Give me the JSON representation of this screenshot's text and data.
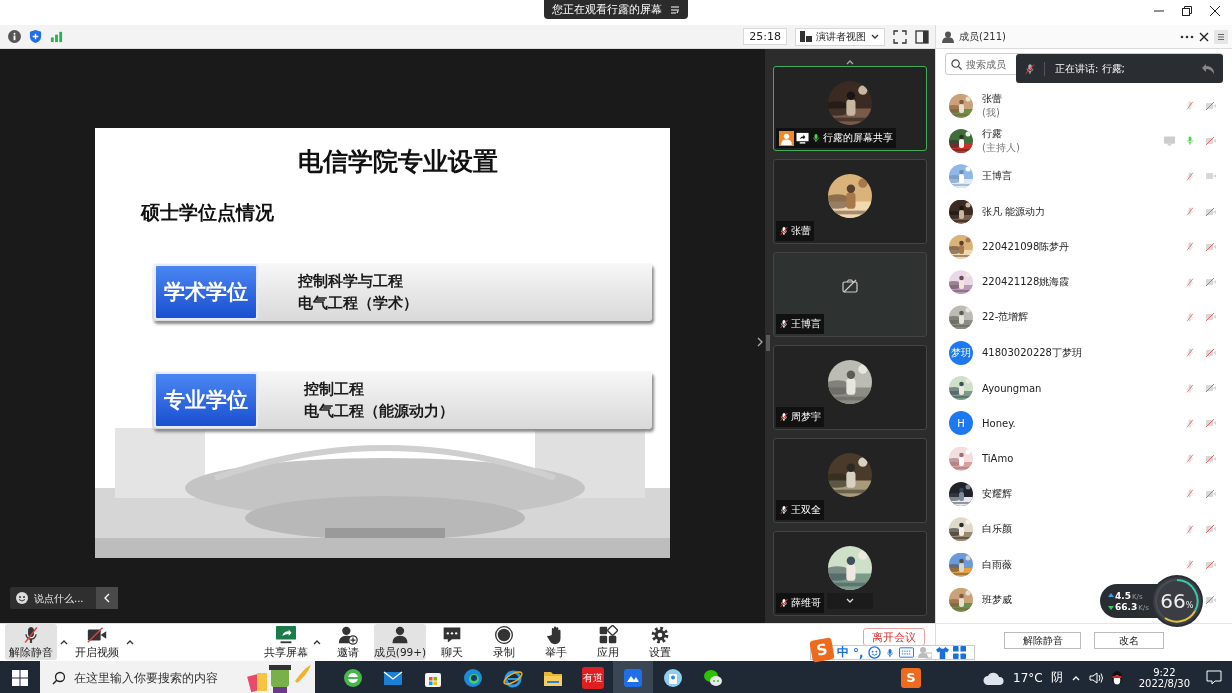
{
  "viewing_banner": {
    "text": "您正在观看行露的屏幕"
  },
  "toolbar": {
    "timer": "25:18",
    "view_mode": "演讲者视图"
  },
  "stage": {
    "slide": {
      "title": "电信学院专业设置",
      "subtitle": "硕士学位点情况",
      "degrees": [
        {
          "label": "学术学位",
          "programs": [
            "控制科学与工程",
            "电气工程（学术）"
          ]
        },
        {
          "label": "专业学位",
          "programs": [
            "控制工程",
            "电气工程（能源动力）"
          ]
        }
      ]
    },
    "chat_placeholder": "说点什么..."
  },
  "thumbnails": [
    {
      "kind": "host",
      "label": "行露的屏幕共享",
      "muted": false,
      "active": true
    },
    {
      "kind": "picture",
      "label": "张蕾",
      "muted": true,
      "active": false
    },
    {
      "kind": "camera-off",
      "label": "王博言",
      "muted": true,
      "active": false
    },
    {
      "kind": "picture",
      "label": "周梦宇",
      "muted": true,
      "active": false
    },
    {
      "kind": "picture",
      "label": "王双全",
      "muted": true,
      "active": false
    },
    {
      "kind": "picture",
      "label": "薛维哥",
      "muted": true,
      "active": false
    }
  ],
  "members_panel": {
    "title": "成员(211)",
    "search": {
      "placeholder": "搜索成员"
    },
    "speaking_toast": "正在讲话: 行露;",
    "members": [
      {
        "name": "张蕾",
        "role": "(我)",
        "mic_muted": true,
        "sharing": false,
        "video_off": true
      },
      {
        "name": "行露",
        "role": "(主持人)",
        "mic_muted": false,
        "sharing": true,
        "video_off": true
      },
      {
        "name": "王博言",
        "mic_muted": true,
        "sharing": false,
        "video_off": false
      },
      {
        "name": "张凡 能源动力",
        "mic_muted": true,
        "sharing": false,
        "video_off": true
      },
      {
        "name": "220421098陈梦丹",
        "mic_muted": true,
        "sharing": false,
        "video_off": true
      },
      {
        "name": "220421128姚海霞",
        "mic_muted": true,
        "sharing": false,
        "video_off": true
      },
      {
        "name": "22-范增辉",
        "mic_muted": true,
        "sharing": false,
        "video_off": true
      },
      {
        "name": "41803020228丁梦玥",
        "avatar": {
          "kind": "letter",
          "text": "梦玥"
        },
        "mic_muted": true,
        "sharing": false,
        "video_off": true
      },
      {
        "name": "Ayoungman",
        "mic_muted": true,
        "sharing": false,
        "video_off": true
      },
      {
        "name": "Honey.",
        "avatar": {
          "kind": "letter",
          "text": "H"
        },
        "mic_muted": true,
        "sharing": false,
        "video_off": true
      },
      {
        "name": "TiAmo",
        "mic_muted": true,
        "sharing": false,
        "video_off": true
      },
      {
        "name": "安耀辉",
        "mic_muted": true,
        "sharing": false,
        "video_off": true
      },
      {
        "name": "白乐颜",
        "mic_muted": true,
        "sharing": false,
        "video_off": true
      },
      {
        "name": "白雨薇",
        "mic_muted": true,
        "sharing": false,
        "video_off": true
      },
      {
        "name": "班梦威",
        "sharing": false,
        "video_off": true
      }
    ],
    "footer_buttons": [
      "解除静音",
      "改名"
    ]
  },
  "network_widget": {
    "upload": {
      "value": "4.5",
      "unit": "K/s"
    },
    "download": {
      "value": "66.3",
      "unit": "K/s"
    },
    "usage": "66",
    "usage_unit": "%"
  },
  "meeting_toolbar": {
    "left_controls": [
      {
        "kind": "mic-muted",
        "label": "解除静音",
        "caret": true,
        "highlighted": true
      },
      {
        "kind": "video-off",
        "label": "开启视频",
        "caret": true,
        "highlighted": false
      }
    ],
    "center_controls": [
      {
        "kind": "share",
        "label": "共享屏幕",
        "caret": true,
        "highlighted": false
      },
      {
        "kind": "invite",
        "label": "邀请",
        "caret": false,
        "highlighted": false
      },
      {
        "kind": "members",
        "label": "成员(99+)",
        "caret": false,
        "highlighted": true
      },
      {
        "kind": "chat",
        "label": "聊天",
        "caret": false,
        "highlighted": false
      },
      {
        "kind": "record",
        "label": "录制",
        "caret": false,
        "highlighted": false
      },
      {
        "kind": "hand",
        "label": "举手",
        "caret": false,
        "highlighted": false
      },
      {
        "kind": "apps",
        "label": "应用",
        "caret": false,
        "highlighted": false
      },
      {
        "kind": "settings",
        "label": "设置",
        "caret": false,
        "highlighted": false
      }
    ],
    "leave_button": "离开会议"
  },
  "ime_bar": {
    "logo": "S",
    "mode": "中",
    "punct": "°,"
  },
  "taskbar": {
    "search_placeholder": "在这里输入你要搜索的内容",
    "apps": [
      {
        "kind": "edge-legacy",
        "active": false
      },
      {
        "kind": "mail",
        "active": false
      },
      {
        "kind": "store",
        "active": false
      },
      {
        "kind": "edge",
        "active": false
      },
      {
        "kind": "ie",
        "active": false
      },
      {
        "kind": "folder",
        "active": false
      },
      {
        "kind": "youdao",
        "text": "有道",
        "active": false
      },
      {
        "kind": "meeting",
        "active": true
      },
      {
        "kind": "badge-app",
        "active": false
      },
      {
        "kind": "wechat",
        "active": false
      }
    ],
    "pinned_text": "S",
    "temperature": "17°C",
    "condition": "阴",
    "time": "9:22",
    "date": "2022/8/30"
  }
}
